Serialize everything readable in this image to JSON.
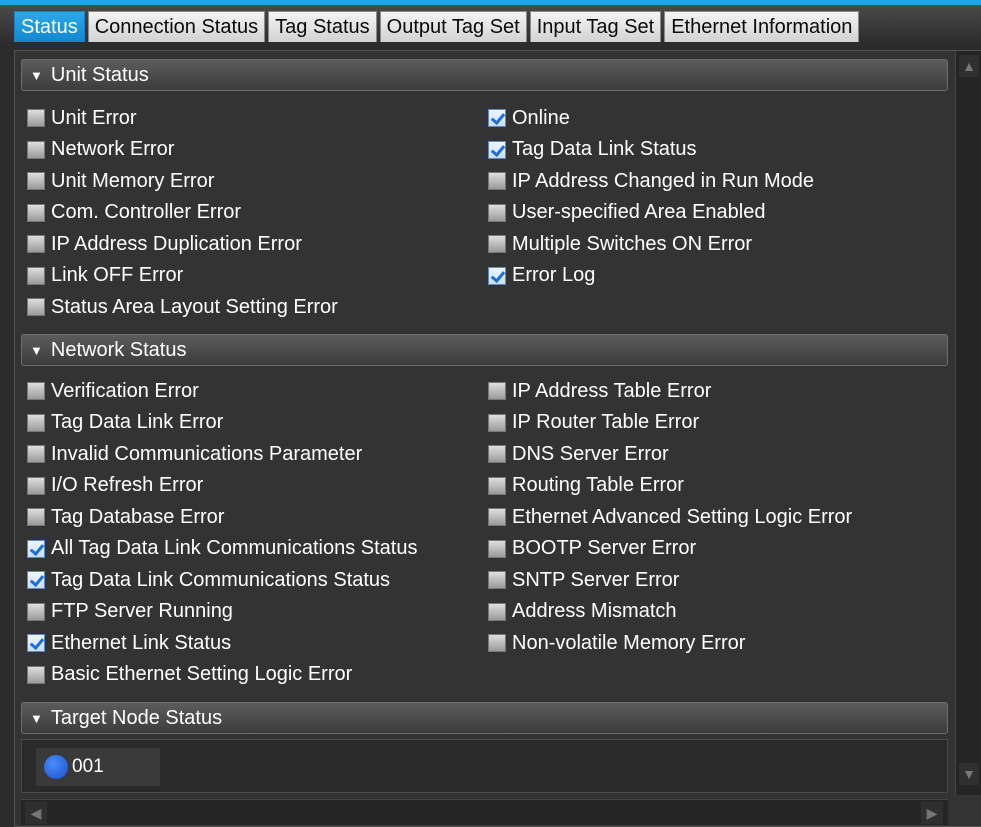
{
  "tabs": [
    {
      "label": "Status",
      "active": true
    },
    {
      "label": "Connection Status",
      "active": false
    },
    {
      "label": "Tag Status",
      "active": false
    },
    {
      "label": "Output Tag Set",
      "active": false
    },
    {
      "label": "Input Tag Set",
      "active": false
    },
    {
      "label": "Ethernet Information",
      "active": false
    }
  ],
  "unit_status": {
    "header": "Unit Status",
    "left": [
      {
        "label": "Unit Error",
        "checked": false
      },
      {
        "label": "Network Error",
        "checked": false
      },
      {
        "label": "Unit Memory Error",
        "checked": false
      },
      {
        "label": "Com. Controller Error",
        "checked": false
      },
      {
        "label": "IP Address Duplication Error",
        "checked": false
      },
      {
        "label": "Link OFF Error",
        "checked": false
      },
      {
        "label": "Status Area Layout Setting Error",
        "checked": false
      }
    ],
    "right": [
      {
        "label": "Online",
        "checked": true
      },
      {
        "label": "Tag Data Link Status",
        "checked": true
      },
      {
        "label": "IP Address Changed in Run Mode",
        "checked": false
      },
      {
        "label": "User-specified Area Enabled",
        "checked": false
      },
      {
        "label": "Multiple Switches ON Error",
        "checked": false
      },
      {
        "label": "Error Log",
        "checked": true
      }
    ]
  },
  "network_status": {
    "header": "Network Status",
    "left": [
      {
        "label": "Verification Error",
        "checked": false
      },
      {
        "label": "Tag Data Link Error",
        "checked": false
      },
      {
        "label": "Invalid Communications Parameter",
        "checked": false
      },
      {
        "label": "I/O Refresh Error",
        "checked": false
      },
      {
        "label": "Tag Database Error",
        "checked": false
      },
      {
        "label": "All Tag Data Link Communications Status",
        "checked": true
      },
      {
        "label": "Tag Data Link Communications Status",
        "checked": true
      },
      {
        "label": "FTP Server Running",
        "checked": false
      },
      {
        "label": "Ethernet Link Status",
        "checked": true
      },
      {
        "label": "Basic Ethernet Setting Logic Error",
        "checked": false
      }
    ],
    "right": [
      {
        "label": "IP Address Table Error",
        "checked": false
      },
      {
        "label": "IP Router Table Error",
        "checked": false
      },
      {
        "label": "DNS Server Error",
        "checked": false
      },
      {
        "label": "Routing Table Error",
        "checked": false
      },
      {
        "label": "Ethernet Advanced Setting Logic Error",
        "checked": false
      },
      {
        "label": "BOOTP Server Error",
        "checked": false
      },
      {
        "label": "SNTP Server Error",
        "checked": false
      },
      {
        "label": "Address Mismatch",
        "checked": false
      },
      {
        "label": "Non-volatile Memory Error",
        "checked": false
      }
    ]
  },
  "target_node_status": {
    "header": "Target Node Status",
    "node": {
      "label": "001",
      "indicator": "blue-circle-icon"
    }
  },
  "colors": {
    "accent": "#1ea3e6",
    "check": "#1c6fd6",
    "node": "#2a62e0"
  }
}
